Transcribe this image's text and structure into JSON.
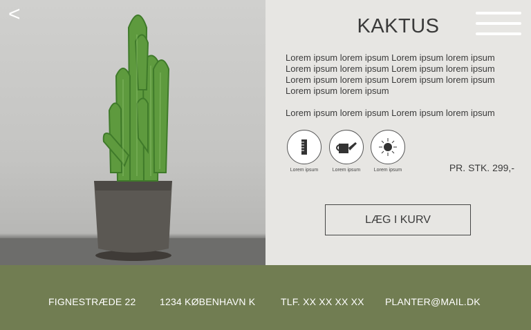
{
  "navigation": {
    "back_icon": "chevron-left-icon",
    "back_glyph": "<",
    "menu_icon": "hamburger-menu-icon"
  },
  "product": {
    "image_alt": "cactus in concrete pot",
    "title": "KAKTUS",
    "description": [
      "Lorem ipsum lorem ipsum Lorem ipsum lorem ipsum Lorem ipsum lorem ipsum Lorem ipsum lorem ipsum Lorem ipsum lorem ipsum Lorem ipsum lorem ipsum Lorem ipsum lorem ipsum",
      "Lorem ipsum lorem ipsum Lorem ipsum lorem ipsum"
    ],
    "care_icons": [
      {
        "icon": "ruler-icon",
        "label": "Lorem ipsum"
      },
      {
        "icon": "watering-can-icon",
        "label": "Lorem ipsum"
      },
      {
        "icon": "sun-icon",
        "label": "Lorem ipsum"
      }
    ],
    "price": "PR. STK. 299,-",
    "cart_button": "LÆG I KURV"
  },
  "footer": {
    "address": "FIGNESTRÆDE 22",
    "city": "1234 KØBENHAVN K",
    "phone": "TLF. XX XX XX XX",
    "email": "PLANTER@MAIL.DK"
  },
  "colors": {
    "panel_bg": "#e7e6e3",
    "footer_bg": "#717d52",
    "text": "#3a3a3a"
  }
}
